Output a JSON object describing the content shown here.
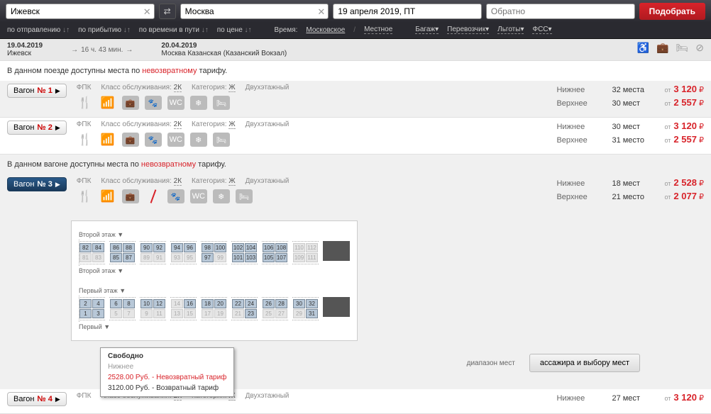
{
  "search": {
    "from": "Ижевск",
    "to": "Москва",
    "date": "19 апреля 2019, ПТ",
    "return_placeholder": "Обратно",
    "submit": "Подобрать"
  },
  "filters": {
    "by_departure": "по отправлению",
    "by_arrival": "по прибытию",
    "by_duration": "по времени в пути",
    "by_price": "по цене",
    "time_label": "Время:",
    "time_moscow": "Московское",
    "time_local": "Местное",
    "baggage": "Багаж",
    "carrier": "Перевозчик",
    "benefits": "Льготы",
    "fss": "ФСС"
  },
  "route": {
    "dep_date": "19.04.2019",
    "dep_station": "Ижевск",
    "duration": "16 ч. 43 мин.",
    "arr_date": "20.04.2019",
    "arr_station": "Москва Казанская (Казанский Вокзал)"
  },
  "non_refund_train": "В данном поезде доступны места по",
  "non_refund_word": "невозвратному",
  "non_refund_tail": "тарифу.",
  "non_refund_wagon": "В данном вагоне доступны места по",
  "meta": {
    "fpk": "ФПК",
    "class_label": "Класс обслуживания:",
    "class_val": "2К",
    "cat_label": "Категория:",
    "cat_val": "Ж",
    "double_deck": "Двухэтажный"
  },
  "wagons": [
    {
      "btn": "Вагон",
      "num": "№ 1",
      "lower_type": "Нижнее",
      "lower_count": "32 места",
      "lower_price": "3 120",
      "upper_type": "Верхнее",
      "upper_count": "30 мест",
      "upper_price": "2 557"
    },
    {
      "btn": "Вагон",
      "num": "№ 2",
      "lower_type": "Нижнее",
      "lower_count": "30 мест",
      "lower_price": "3 120",
      "upper_type": "Верхнее",
      "upper_count": "31 место",
      "upper_price": "2 557"
    },
    {
      "btn": "Вагон",
      "num": "№ 3",
      "lower_type": "Нижнее",
      "lower_count": "18 мест",
      "lower_price": "2 528",
      "upper_type": "Верхнее",
      "upper_count": "21 место",
      "upper_price": "2 077"
    },
    {
      "btn": "Вагон",
      "num": "№ 4",
      "lower_type": "Нижнее",
      "lower_count": "27 мест",
      "lower_price": "3 120"
    }
  ],
  "ot": "от",
  "rub": "₽",
  "seatmap": {
    "floor2": "Второй этаж",
    "floor1": "Первый этаж",
    "deck2": [
      [
        [
          82,
          84
        ],
        [
          81,
          83
        ]
      ],
      [
        [
          86,
          88
        ],
        [
          85,
          87
        ]
      ],
      [
        [
          90,
          92
        ],
        [
          89,
          91
        ]
      ],
      [
        [
          94,
          96
        ],
        [
          93,
          95
        ]
      ],
      [
        [
          98,
          100
        ],
        [
          97,
          99
        ]
      ],
      [
        [
          102,
          104
        ],
        [
          101,
          103
        ]
      ],
      [
        [
          106,
          108
        ],
        [
          105,
          107
        ]
      ],
      [
        [
          110,
          112
        ],
        [
          109,
          111
        ]
      ]
    ],
    "deck2_taken": [
      81,
      83,
      89,
      91,
      93,
      95,
      99,
      109,
      110,
      111,
      112
    ],
    "deck1": [
      [
        [
          2,
          4
        ],
        [
          1,
          3
        ]
      ],
      [
        [
          6,
          8
        ],
        [
          5,
          7
        ]
      ],
      [
        [
          10,
          12
        ],
        [
          9,
          11
        ]
      ],
      [
        [
          14,
          16
        ],
        [
          13,
          15
        ]
      ],
      [
        [
          18,
          20
        ],
        [
          17,
          19
        ]
      ],
      [
        [
          22,
          24
        ],
        [
          21,
          23
        ]
      ],
      [
        [
          26,
          28
        ],
        [
          25,
          27
        ]
      ],
      [
        [
          30,
          32
        ],
        [
          29,
          31
        ]
      ]
    ],
    "deck1_taken": [
      5,
      7,
      9,
      11,
      13,
      14,
      15,
      17,
      19,
      21,
      25,
      27,
      29
    ]
  },
  "tooltip": {
    "title": "Свободно",
    "sub": "Нижнее",
    "nr_price": "2528.00 Руб. - Невозвратный тариф",
    "r_price": "3120.00 Руб. - Возвратный тариф"
  },
  "range_note": "диапазон мест",
  "next_step": "ассажира и выбору мест"
}
